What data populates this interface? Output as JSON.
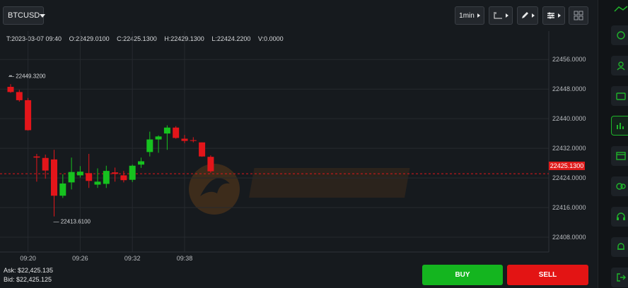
{
  "toolbar": {
    "symbol": "BTCUSD",
    "interval": "1min"
  },
  "ohlc": {
    "time": "T:2023-03-07 09:40",
    "open": "O:22429.0100",
    "close": "C:22425.1300",
    "high": "H:22429.1300",
    "low": "L:22424.2200",
    "volume": "V:0.0000"
  },
  "chart_data": {
    "type": "candlestick",
    "y_ticks": [
      "22456.0000",
      "22448.0000",
      "22440.0000",
      "22432.0000",
      "22424.0000",
      "22416.0000",
      "22408.0000"
    ],
    "y_tick_values": [
      22456,
      22448,
      22440,
      22432,
      22424,
      22416,
      22408
    ],
    "ylim": [
      22404,
      22461
    ],
    "x_ticks": [
      "09:20",
      "09:26",
      "09:32",
      "09:38"
    ],
    "x_tick_index": [
      2,
      8,
      14,
      20
    ],
    "current_price": "22425.1300",
    "current_price_value": 22425.13,
    "high_marker": "22449.3200",
    "high_marker_index": 0,
    "low_marker": "22413.6100",
    "low_marker_index": 5,
    "colors": {
      "up": "#16c21f",
      "down": "#e3151a"
    },
    "candles": [
      {
        "o": 22448.6,
        "h": 22449.32,
        "l": 22447.0,
        "c": 22447.2
      },
      {
        "o": 22447.2,
        "h": 22447.8,
        "l": 22444.6,
        "c": 22445.0
      },
      {
        "o": 22445.0,
        "h": 22445.6,
        "l": 22436.8,
        "c": 22436.9
      },
      {
        "o": 22429.8,
        "h": 22430.5,
        "l": 22423.0,
        "c": 22429.5
      },
      {
        "o": 22429.4,
        "h": 22430.3,
        "l": 22423.8,
        "c": 22426.0
      },
      {
        "o": 22429.0,
        "h": 22431.6,
        "l": 22413.61,
        "c": 22419.2
      },
      {
        "o": 22419.2,
        "h": 22425.0,
        "l": 22418.6,
        "c": 22422.5
      },
      {
        "o": 22422.8,
        "h": 22429.5,
        "l": 22420.9,
        "c": 22425.6
      },
      {
        "o": 22424.7,
        "h": 22427.2,
        "l": 22424.1,
        "c": 22425.7
      },
      {
        "o": 22425.3,
        "h": 22430.5,
        "l": 22421.3,
        "c": 22423.2
      },
      {
        "o": 22422.2,
        "h": 22426.6,
        "l": 22421.3,
        "c": 22423.0
      },
      {
        "o": 22422.4,
        "h": 22427.3,
        "l": 22421.3,
        "c": 22425.9
      },
      {
        "o": 22425.5,
        "h": 22426.8,
        "l": 22423.0,
        "c": 22425.1
      },
      {
        "o": 22424.7,
        "h": 22425.9,
        "l": 22422.8,
        "c": 22423.4
      },
      {
        "o": 22423.5,
        "h": 22427.6,
        "l": 22422.9,
        "c": 22427.3
      },
      {
        "o": 22427.6,
        "h": 22429.5,
        "l": 22426.7,
        "c": 22428.5
      },
      {
        "o": 22431.0,
        "h": 22436.5,
        "l": 22429.8,
        "c": 22434.4
      },
      {
        "o": 22434.4,
        "h": 22435.5,
        "l": 22430.8,
        "c": 22435.2
      },
      {
        "o": 22436.0,
        "h": 22438.2,
        "l": 22431.6,
        "c": 22437.6
      },
      {
        "o": 22437.6,
        "h": 22438.0,
        "l": 22434.6,
        "c": 22434.8
      },
      {
        "o": 22434.6,
        "h": 22435.6,
        "l": 22433.4,
        "c": 22434.0
      },
      {
        "o": 22434.2,
        "h": 22435.0,
        "l": 22433.6,
        "c": 22434.0
      },
      {
        "o": 22433.6,
        "h": 22433.6,
        "l": 22429.7,
        "c": 22429.8
      },
      {
        "o": 22429.7,
        "h": 22430.1,
        "l": 22425.4,
        "c": 22425.8
      }
    ]
  },
  "quotes": {
    "ask": "Ask: $22,425.135",
    "bid": "Bid: $22,425.125"
  },
  "trade": {
    "buy_label": "BUY",
    "sell_label": "SELL"
  },
  "sidebar": {
    "items": [
      {
        "icon": "account-icon"
      },
      {
        "icon": "user-icon"
      },
      {
        "icon": "wallet-icon"
      },
      {
        "icon": "chart-icon",
        "active": true
      },
      {
        "icon": "deposit-icon"
      },
      {
        "icon": "funds-icon"
      },
      {
        "icon": "support-icon"
      },
      {
        "icon": "bell-icon"
      },
      {
        "icon": "logout-icon"
      }
    ]
  }
}
